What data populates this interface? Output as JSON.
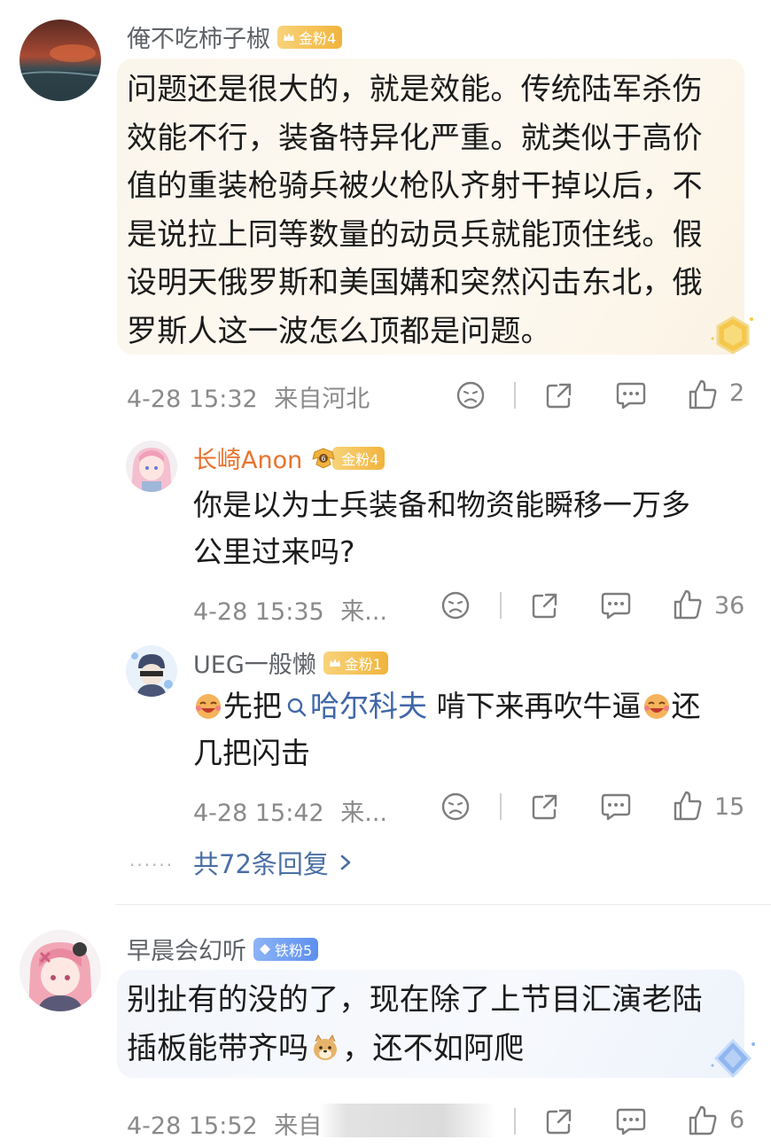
{
  "comments": [
    {
      "username": "俺不吃柿子椒",
      "badge": "金粉4",
      "lines": [
        "问题还是很大的，就是效能。传统陆军杀伤",
        "效能不行，装备特异化严重。就类似于高价",
        "值的重装枪骑兵被火枪队齐射干掉以后，不",
        "是说拉上同等数量的动员兵就能顶住线。假",
        "设明天俄罗斯和美国媾和突然闪击东北，俄",
        "罗斯人这一波怎么顶都是问题。"
      ],
      "time": "4-28 15:32",
      "location": "来自河北",
      "likes": "2"
    },
    {
      "username": "早晨会幻听",
      "badge": "铁粉5",
      "line1": "别扯有的没的了，现在除了上节目汇演老陆",
      "line2_a": "插板能带齐吗",
      "line2_b": "，还不如阿爬",
      "time": "4-28 15:52",
      "location": "来自",
      "likes": "6"
    }
  ],
  "replies": [
    {
      "username": "长崎Anon",
      "badge": "金粉4",
      "lines": [
        "你是以为士兵装备和物资能瞬移一万多",
        "公里过来吗?"
      ],
      "time": "4-28 15:35",
      "location": "来...",
      "likes": "36"
    },
    {
      "username": "UEG一般懒",
      "badge": "金粉1",
      "text_a": "先把",
      "link": "哈尔科夫",
      "text_b": " 啃下来再吹牛逼",
      "text_c": "还",
      "line2": "几把闪击",
      "time": "4-28 15:42",
      "location": "来...",
      "likes": "15"
    }
  ],
  "more_replies": {
    "dots": "......",
    "label": "共72条回复"
  },
  "colors": {
    "accent_orange": "#e8722c",
    "link_blue": "#3f67a8",
    "muted": "#8a8a8a"
  }
}
